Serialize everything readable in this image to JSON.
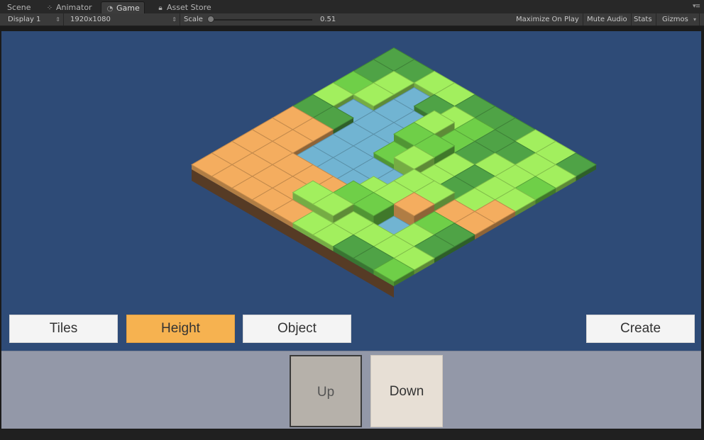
{
  "editor_tabs": [
    {
      "label": "Scene",
      "icon": "scene-icon"
    },
    {
      "label": "Animator",
      "icon": "animator-icon"
    },
    {
      "label": "Game",
      "icon": "game-icon",
      "active": true
    },
    {
      "label": "Asset Store",
      "icon": "lock-icon"
    }
  ],
  "toolbar": {
    "display": "Display 1",
    "resolution": "1920x1080",
    "scale_label": "Scale",
    "scale_value": "0.51",
    "maximize": "Maximize On Play",
    "mute": "Mute Audio",
    "stats": "Stats",
    "gizmos": "Gizmos"
  },
  "game": {
    "tile_colors": {
      "orange": "#f4ad5f",
      "water": "#71b4d2",
      "light_green": "#a2ef5e",
      "mid_green": "#6fcf48",
      "dark_green": "#4fa346"
    },
    "mode_buttons": [
      {
        "label": "Tiles",
        "selected": false
      },
      {
        "label": "Height",
        "selected": true
      },
      {
        "label": "Object",
        "selected": false
      }
    ],
    "create_label": "Create",
    "height_panel": {
      "up_label": "Up",
      "down_label": "Down"
    },
    "selected_color": "#f6b250",
    "background_color": "#2e4b77"
  }
}
